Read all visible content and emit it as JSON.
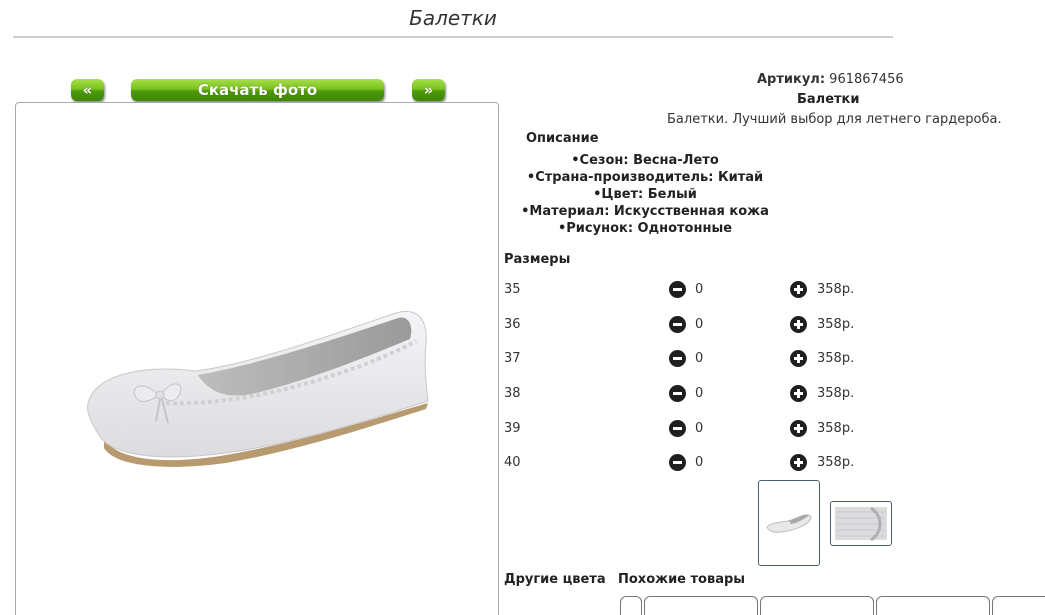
{
  "page": {
    "title": "Балетки"
  },
  "gallery": {
    "prev_label": "«",
    "next_label": "»",
    "download_label": "Скачать фото"
  },
  "product": {
    "sku_label": "Артикул:",
    "sku_value": "961867456",
    "name": "Балетки",
    "tagline": "Балетки. Лучший выбор для летнего гардероба."
  },
  "description": {
    "heading": "Описание",
    "items": [
      "Сезон: Весна-Лето",
      "Страна-производитель: Китай",
      "Цвет: Белый",
      "Материал: Искусственная кожа",
      "Рисунок: Однотонные"
    ]
  },
  "sizes": {
    "heading": "Размеры",
    "rows": [
      {
        "size": "35",
        "qty": "0",
        "price": "358р."
      },
      {
        "size": "36",
        "qty": "0",
        "price": "358р."
      },
      {
        "size": "37",
        "qty": "0",
        "price": "358р."
      },
      {
        "size": "38",
        "qty": "0",
        "price": "358р."
      },
      {
        "size": "39",
        "qty": "0",
        "price": "358р."
      },
      {
        "size": "40",
        "qty": "0",
        "price": "358р."
      }
    ]
  },
  "sections": {
    "other_colors": "Другие цвета",
    "similar": "Похожие товары"
  },
  "colors": {
    "button_green": "#79c11e",
    "thumb_border": "#4a5f7a"
  }
}
